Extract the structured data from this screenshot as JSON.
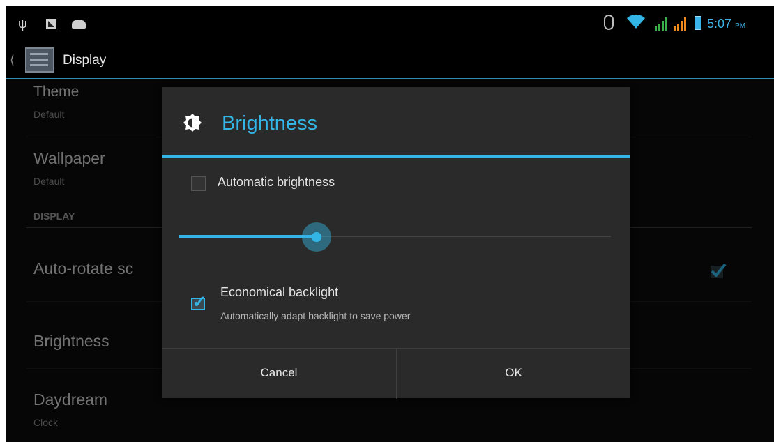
{
  "status_bar": {
    "time": "5:07",
    "ampm": "PM",
    "icons": [
      "usb-icon",
      "notification-icon",
      "notification-icon",
      "bluetooth-icon",
      "wifi-icon",
      "signal-icon",
      "signal-icon",
      "battery-icon"
    ]
  },
  "action_bar": {
    "title": "Display",
    "up_icon": "chevron-left-icon"
  },
  "settings_list": {
    "items": [
      {
        "title": "Theme",
        "summary": "Default"
      },
      {
        "title": "Wallpaper",
        "summary": "Default"
      }
    ],
    "section_header": "DISPLAY",
    "section_items": [
      {
        "title": "Auto-rotate sc",
        "checked": true
      },
      {
        "title": "Brightness"
      },
      {
        "title": "Daydream",
        "summary": "Clock"
      }
    ]
  },
  "dialog": {
    "title": "Brightness",
    "icon": "brightness-icon",
    "automatic_brightness": {
      "label": "Automatic brightness",
      "checked": false
    },
    "slider": {
      "level_fraction": 0.32
    },
    "economical_backlight": {
      "label": "Economical backlight",
      "summary": "Automatically adapt backlight to save power",
      "checked": true
    },
    "buttons": {
      "cancel": "Cancel",
      "ok": "OK"
    }
  },
  "colors": {
    "accent": "#33b5e5",
    "background": "#000000",
    "dialog_bg": "#2a2a2a"
  }
}
